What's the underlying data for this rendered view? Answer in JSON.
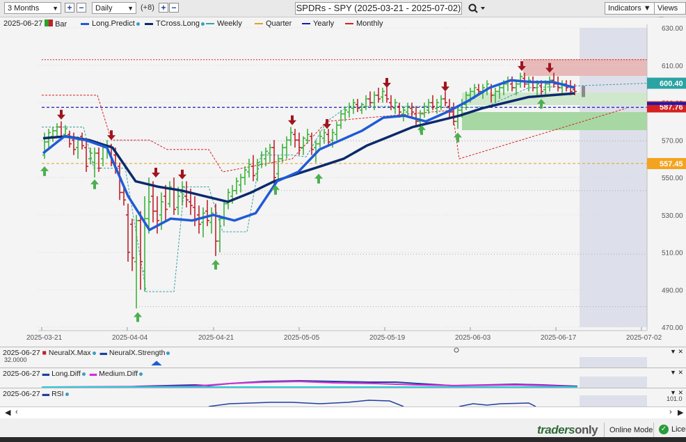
{
  "toolbar": {
    "range": "3 Months",
    "interval": "Daily",
    "offset": "(+8)",
    "title": "SPDRs - SPY (2025-03-21 - 2025-07-02)",
    "indicators_label": "Indicators",
    "views_label": "Views"
  },
  "legend": {
    "date": "2025-06-27",
    "items": [
      {
        "label": "Bar",
        "color": "#2ca02c"
      },
      {
        "label": "Long.Predict",
        "color": "#1f5bd6"
      },
      {
        "label": "TCross.Long",
        "color": "#0c2a6b"
      },
      {
        "label": "Weekly",
        "color": "#3aa0a8"
      },
      {
        "label": "Quarter",
        "color": "#e0a020"
      },
      {
        "label": "Yearly",
        "color": "#1a1ab0"
      },
      {
        "label": "Monthly",
        "color": "#d62020"
      }
    ]
  },
  "colors": {
    "up": "#3bb33b",
    "down": "#c0202a",
    "long_predict": "#1f5bd6",
    "tcross": "#0c2a6b",
    "weekly": "#3aa0a8",
    "quarter": "#e0a020",
    "yearly": "#1a1ab0",
    "monthly": "#d62020",
    "tag_weekly": "#2ba3a3",
    "tag_monthly": "#d62020",
    "tag_quarter": "#f4a320"
  },
  "chart_data": {
    "type": "candlestick",
    "x_dates": [
      "2025-03-21",
      "2025-04-04",
      "2025-04-21",
      "2025-05-05",
      "2025-05-19",
      "2025-06-03",
      "2025-06-17",
      "2025-07-02"
    ],
    "ylim": [
      470,
      630
    ],
    "y_ticks": [
      "630.00",
      "610.00",
      "590.00",
      "570.00",
      "550.00",
      "530.00",
      "510.00",
      "490.00",
      "470.00"
    ],
    "price_tags": {
      "weekly": "600.40",
      "monthly": "587.76",
      "quarter": "557.45"
    },
    "series": [
      {
        "name": "Long.Predict",
        "values": [
          563,
          572,
          570,
          566,
          540,
          522,
          528,
          527,
          530,
          527,
          531,
          548,
          553,
          565,
          570,
          575,
          582,
          583,
          580,
          585,
          591,
          598,
          602,
          601,
          601,
          598
        ]
      },
      {
        "name": "TCross.Long",
        "values": [
          571,
          572,
          570,
          566,
          548,
          545,
          543,
          540,
          537,
          542,
          548,
          552,
          556,
          560,
          567,
          572,
          577,
          580,
          583,
          587,
          590,
          593,
          594,
          595
        ]
      }
    ]
  },
  "panes": [
    {
      "date": "2025-06-27",
      "labels": [
        "NeuralX.Max",
        "NeuralX.Strength"
      ],
      "value": "32.0000"
    },
    {
      "date": "2025-06-27",
      "labels": [
        "Long.Diff",
        "Medium.Diff"
      ]
    },
    {
      "date": "2025-06-27",
      "labels": [
        "RSI"
      ],
      "value": "101.0"
    }
  ],
  "status": {
    "brand_a": "traders",
    "brand_b": "only",
    "mode": "Online Mode",
    "license": "Licen"
  }
}
